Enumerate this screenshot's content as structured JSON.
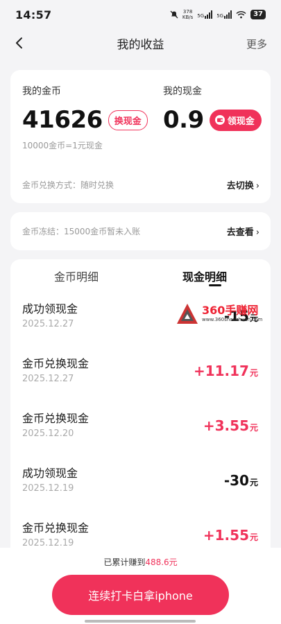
{
  "status_bar": {
    "time": "14:57",
    "network_speed_value": "378",
    "network_speed_unit": "KB/s",
    "signal_1_label": "5G",
    "signal_2_label": "5G",
    "battery": "37",
    "icons": [
      "mute-bell-icon",
      "signal-icon",
      "signal-icon",
      "wifi-icon",
      "battery-icon"
    ]
  },
  "header": {
    "title": "我的收益",
    "more_label": "更多",
    "back_icon": "chevron-left-icon"
  },
  "coins": {
    "label": "我的金币",
    "value": "41626",
    "exchange_button": "换现金",
    "rate_text": "10000金币=1元现金"
  },
  "cash": {
    "label": "我的现金",
    "value": "0.9",
    "withdraw_button": "领现金"
  },
  "exchange_method": {
    "label": "金币兑换方式：随时兑换",
    "action": "去切换"
  },
  "freeze": {
    "label": "金币冻结：15000金币暂未入账",
    "action": "去查看"
  },
  "tabs": [
    {
      "label": "金币明细",
      "active": false
    },
    {
      "label": "现金明细",
      "active": true
    }
  ],
  "transactions": [
    {
      "title": "成功领现金",
      "date": "2025.12.27",
      "amount": "-15",
      "unit": "元",
      "type": "negative"
    },
    {
      "title": "金币兑换现金",
      "date": "2025.12.27",
      "amount": "+11.17",
      "unit": "元",
      "type": "positive"
    },
    {
      "title": "金币兑换现金",
      "date": "2025.12.20",
      "amount": "+3.55",
      "unit": "元",
      "type": "positive"
    },
    {
      "title": "成功领现金",
      "date": "2025.12.19",
      "amount": "-30",
      "unit": "元",
      "type": "negative"
    },
    {
      "title": "金币兑换现金",
      "date": "2025.12.19",
      "amount": "+1.55",
      "unit": "元",
      "type": "positive"
    }
  ],
  "watermark": {
    "title": "360手赚网",
    "url": "www.360shouzhuan.com"
  },
  "bottom": {
    "accum_prefix": "已累计赚到",
    "accum_value": "488.6元",
    "cta_label": "连续打卡白拿iphone"
  },
  "colors": {
    "accent": "#f0325a",
    "background": "#f4f4f6",
    "card": "#ffffff"
  }
}
